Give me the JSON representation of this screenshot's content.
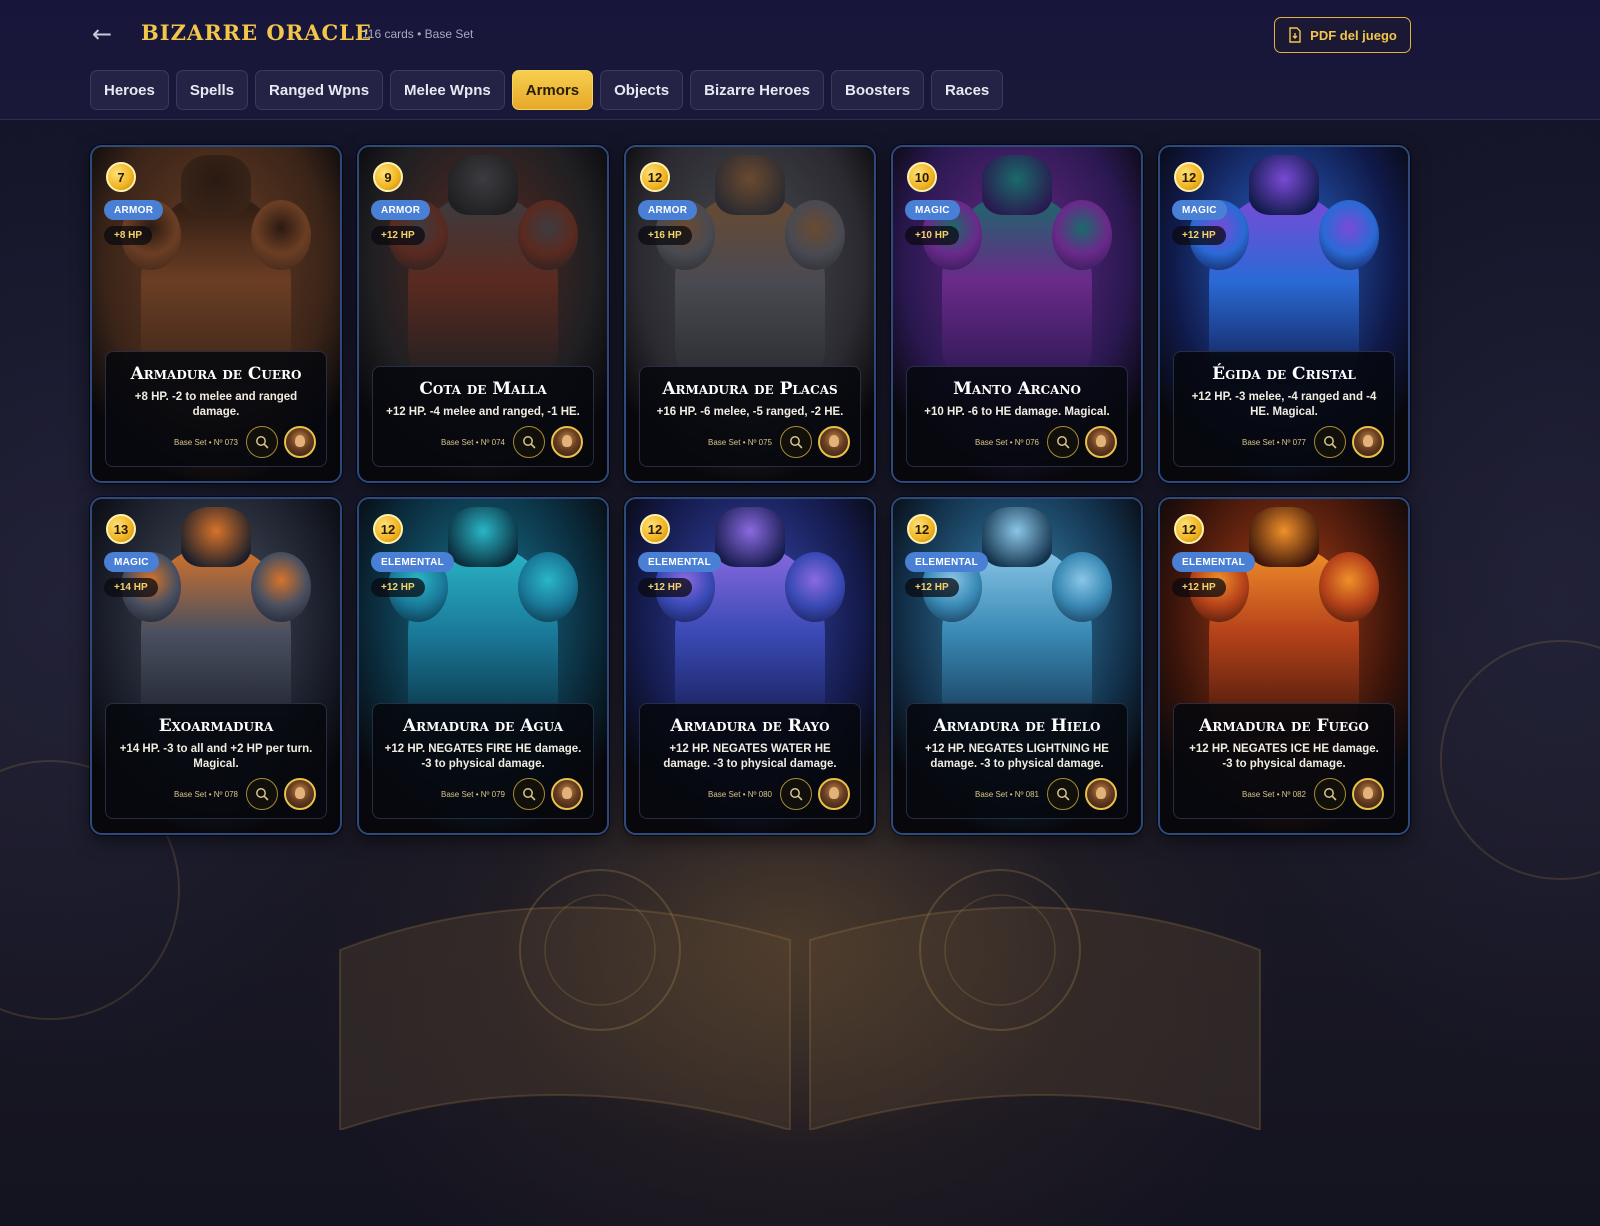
{
  "header": {
    "back_label": "←",
    "brand": "BIZARRE ORACLE",
    "subtitle": "116 cards • Base Set",
    "pdf_label": "PDF del juego"
  },
  "tabs": [
    {
      "label": "Heroes",
      "active": false
    },
    {
      "label": "Spells",
      "active": false
    },
    {
      "label": "Ranged Wpns",
      "active": false
    },
    {
      "label": "Melee Wpns",
      "active": false
    },
    {
      "label": "Armors",
      "active": true
    },
    {
      "label": "Objects",
      "active": false
    },
    {
      "label": "Bizarre Heroes",
      "active": false
    },
    {
      "label": "Boosters",
      "active": false
    },
    {
      "label": "Races",
      "active": false
    }
  ],
  "cards": [
    {
      "cost": "7",
      "type": "ARMOR",
      "hp": "+8 HP",
      "title": "Armadura de Cuero",
      "desc": "+8 HP. -2 to melee and ranged damage.",
      "set": "Base Set • Nº 073",
      "palette": [
        "#3a2418",
        "#6b3e24",
        "#2a1a12"
      ]
    },
    {
      "cost": "9",
      "type": "ARMOR",
      "hp": "+12 HP",
      "title": "Cota de Malla",
      "desc": "+12 HP. -4 melee and ranged, -1 HE.",
      "set": "Base Set • Nº 074",
      "palette": [
        "#1f1f22",
        "#5a2a20",
        "#3c3c40"
      ]
    },
    {
      "cost": "12",
      "type": "ARMOR",
      "hp": "+16 HP",
      "title": "Armadura de Placas",
      "desc": "+16 HP. -6 melee, -5 ranged, -2 HE.",
      "set": "Base Set • Nº 075",
      "palette": [
        "#2a2a30",
        "#4a4a52",
        "#6a4a30"
      ]
    },
    {
      "cost": "10",
      "type": "MAGIC",
      "hp": "+10 HP",
      "title": "Manto Arcano",
      "desc": "+10 HP. -6 to HE damage. Magical.",
      "set": "Base Set • Nº 076",
      "palette": [
        "#2a1850",
        "#6a2a8a",
        "#1a6a6a"
      ]
    },
    {
      "cost": "12",
      "type": "MAGIC",
      "hp": "+12 HP",
      "title": "Égida de Cristal",
      "desc": "+12 HP. -3 melee, -4 ranged and -4 HE. Magical.",
      "set": "Base Set • Nº 077",
      "palette": [
        "#101a4a",
        "#2a6ad6",
        "#7a4ad6"
      ]
    },
    {
      "cost": "13",
      "type": "MAGIC",
      "hp": "+14 HP",
      "title": "Exoarmadura",
      "desc": "+14 HP. -3 to all and +2 HP per turn. Magical.",
      "set": "Base Set • Nº 078",
      "palette": [
        "#1a1e2a",
        "#4a5060",
        "#d6732a"
      ]
    },
    {
      "cost": "12",
      "type": "ELEMENTAL",
      "hp": "+12 HP",
      "title": "Armadura de Agua",
      "desc": "+12 HP. NEGATES FIRE HE damage. -3 to physical damage.",
      "set": "Base Set • Nº 079",
      "palette": [
        "#0a2a3a",
        "#1a7a9a",
        "#2ab6c6"
      ]
    },
    {
      "cost": "12",
      "type": "ELEMENTAL",
      "hp": "+12 HP",
      "title": "Armadura de Rayo",
      "desc": "+12 HP. NEGATES WATER HE damage. -3 to physical damage.",
      "set": "Base Set • Nº 080",
      "palette": [
        "#141a4a",
        "#3a4ab6",
        "#8a6ae0"
      ]
    },
    {
      "cost": "12",
      "type": "ELEMENTAL",
      "hp": "+12 HP",
      "title": "Armadura de Hielo",
      "desc": "+12 HP. NEGATES LIGHTNING HE damage. -3 to physical damage.",
      "set": "Base Set • Nº 081",
      "palette": [
        "#12304a",
        "#3a8ab6",
        "#8ac6e6"
      ]
    },
    {
      "cost": "12",
      "type": "ELEMENTAL",
      "hp": "+12 HP",
      "title": "Armadura de Fuego",
      "desc": "+12 HP. NEGATES ICE HE damage. -3 to physical damage.",
      "set": "Base Set • Nº 082",
      "palette": [
        "#3a140a",
        "#b6421a",
        "#f0902a"
      ]
    }
  ],
  "colors": {
    "accent": "#f3c64a",
    "type_badge": "#4a7fd6",
    "card_border": "#2d4a7e",
    "tab_bg": "#242345"
  },
  "icons": {
    "back": "arrow-left-icon",
    "pdf": "file-download-icon",
    "zoom": "magnifier-icon",
    "avatar": "character-portrait-icon"
  }
}
